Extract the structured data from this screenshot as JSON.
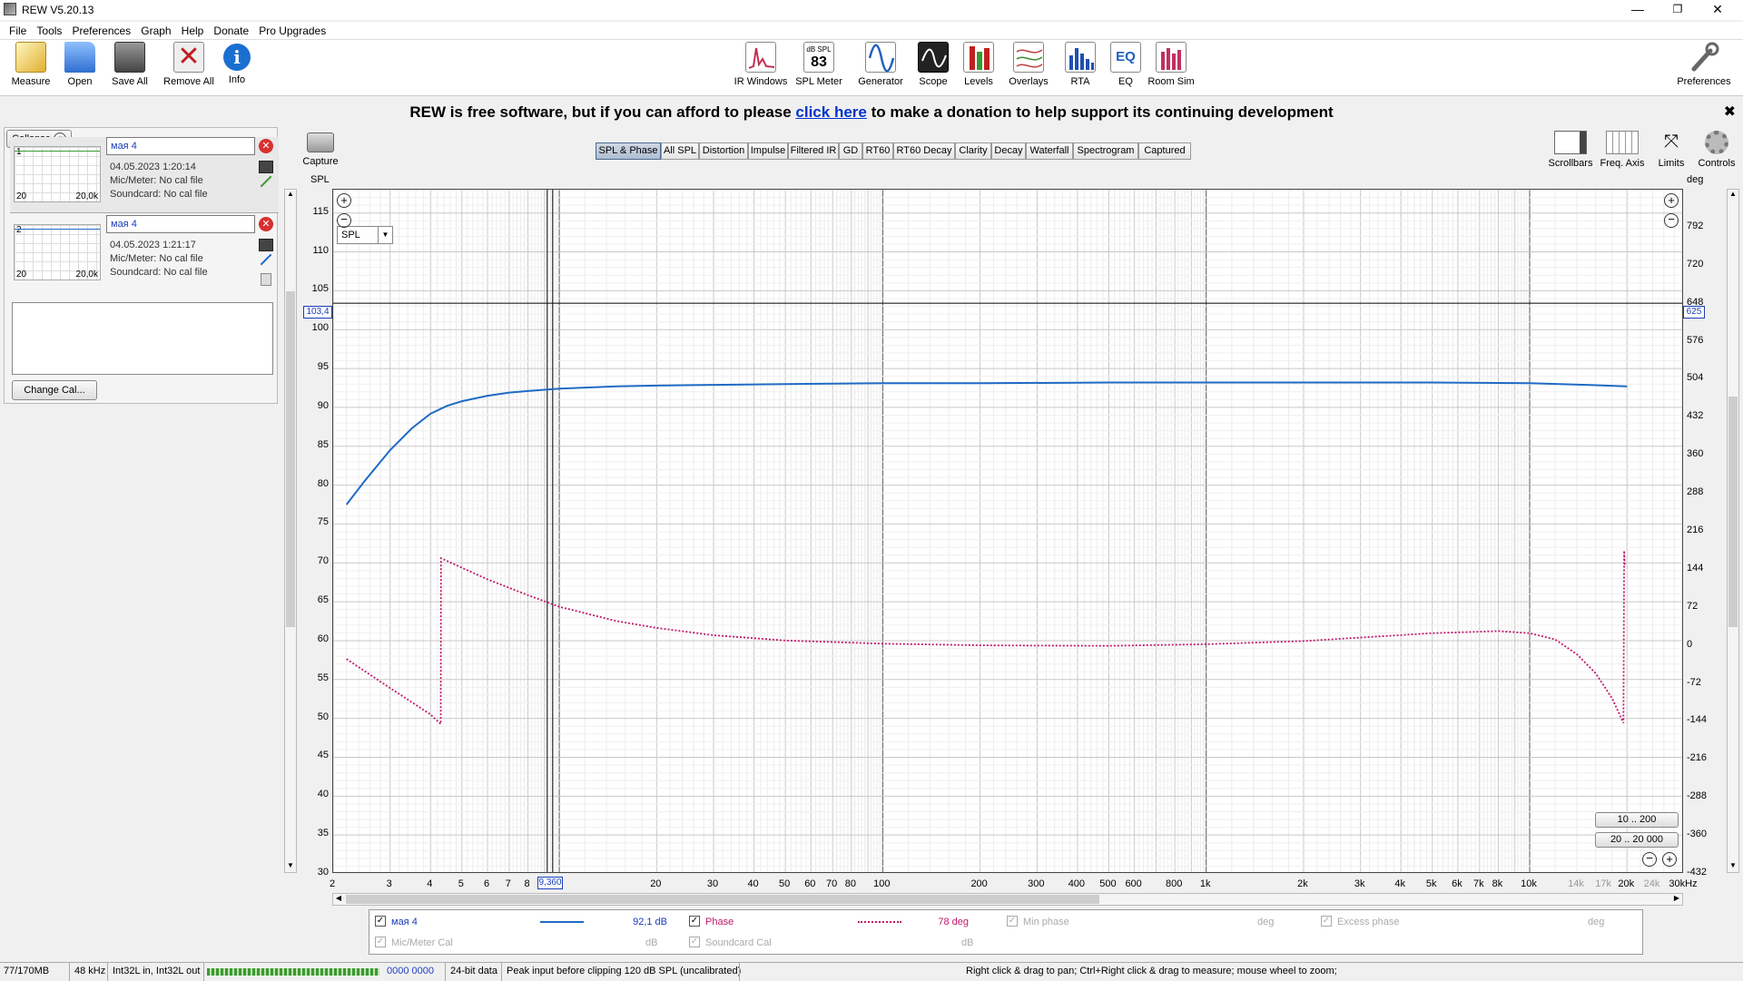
{
  "window": {
    "title": "REW V5.20.13",
    "min": "—",
    "max": "❐",
    "close": "✕"
  },
  "menu": [
    "File",
    "Tools",
    "Preferences",
    "Graph",
    "Help",
    "Donate",
    "Pro Upgrades"
  ],
  "toolbar_left": [
    {
      "label": "Measure",
      "icon": "measure-icon",
      "color": "#d8b030"
    },
    {
      "label": "Open",
      "icon": "folder-icon",
      "color": "#3a7bd5"
    },
    {
      "label": "Save All",
      "icon": "save-icon",
      "color": "#555555"
    },
    {
      "label": "Remove All",
      "icon": "remove-icon",
      "color": "#c02020"
    },
    {
      "label": "Info",
      "icon": "info-icon",
      "color": "#1a6fd0"
    }
  ],
  "toolbar_center": [
    {
      "label": "IR Windows",
      "icon": "ir-windows-icon",
      "color": "#c03050"
    },
    {
      "label": "SPL Meter",
      "icon": "spl-meter-icon",
      "color": "#333333",
      "top": "dB SPL",
      "value": "83"
    },
    {
      "label": "Generator",
      "icon": "generator-icon",
      "color": "#2060c0"
    },
    {
      "label": "Scope",
      "icon": "scope-icon",
      "color": "#222222"
    },
    {
      "label": "Levels",
      "icon": "levels-icon",
      "color": "#c02020"
    },
    {
      "label": "Overlays",
      "icon": "overlays-icon",
      "color": "#c04040"
    },
    {
      "label": "RTA",
      "icon": "rta-icon",
      "color": "#2050b0"
    },
    {
      "label": "EQ",
      "icon": "eq-icon",
      "color": "#2060c0"
    },
    {
      "label": "Room Sim",
      "icon": "room-sim-icon",
      "color": "#c03060"
    }
  ],
  "toolbar_right": {
    "label": "Preferences",
    "icon": "wrench-icon"
  },
  "banner": {
    "prefix": "REW is free software, but if you can afford to please ",
    "link": "click here",
    "suffix": " to make a donation to help support its continuing development",
    "close": "✖"
  },
  "panel": {
    "collapse": "Collapse",
    "collapse_glyph": "«",
    "change_cal": "Change Cal...",
    "measurements": [
      {
        "index": "1",
        "name": "мая 4",
        "date": "04.05.2023 1:20:14",
        "mic": "Mic/Meter: No cal file",
        "soundcard": "Soundcard: No cal file",
        "x0": "20",
        "x1": "20,0k"
      },
      {
        "index": "2",
        "name": "мая 4",
        "date": "04.05.2023 1:21:17",
        "mic": "Mic/Meter: No cal file",
        "soundcard": "Soundcard: No cal file",
        "x0": "20",
        "x1": "20,0k"
      }
    ]
  },
  "capture": {
    "label": "Capture",
    "icon": "camera-icon"
  },
  "graph_tabs": [
    "SPL & Phase",
    "All SPL",
    "Distortion",
    "Impulse",
    "Filtered IR",
    "GD",
    "RT60",
    "RT60 Decay",
    "Clarity",
    "Decay",
    "Waterfall",
    "Spectrogram",
    "Captured"
  ],
  "graph_tools": [
    {
      "label": "Scrollbars",
      "icon": "scrollbars-icon"
    },
    {
      "label": "Freq. Axis",
      "icon": "freq-axis-icon"
    },
    {
      "label": "Limits",
      "icon": "limits-icon"
    },
    {
      "label": "Controls",
      "icon": "gear-icon"
    }
  ],
  "axis": {
    "left_title": "SPL",
    "right_title": "deg",
    "spl_selector": "SPL",
    "cursor_left": "103,4",
    "cursor_right": "625",
    "cursor_x": "9,360",
    "left_ticks": [
      "115",
      "110",
      "105",
      "100",
      "95",
      "90",
      "85",
      "80",
      "75",
      "70",
      "65",
      "60",
      "55",
      "50",
      "45",
      "40",
      "35",
      "30"
    ],
    "right_ticks": [
      "792",
      "720",
      "648",
      "576",
      "504",
      "432",
      "360",
      "288",
      "216",
      "144",
      "72",
      "0",
      "-72",
      "-144",
      "-216",
      "-288",
      "-360",
      "-432"
    ],
    "x_ticks": [
      "2",
      "3",
      "4",
      "5",
      "6",
      "7",
      "8",
      "20",
      "30",
      "40",
      "50",
      "60",
      "70",
      "80",
      "100",
      "200",
      "300",
      "400",
      "500",
      "600",
      "800",
      "1k",
      "2k",
      "3k",
      "4k",
      "5k",
      "6k",
      "7k",
      "8k",
      "10k",
      "14k",
      "17k",
      "20k",
      "24k",
      "30kHz"
    ],
    "range_buttons": [
      "10 .. 200",
      "20 .. 20 000"
    ]
  },
  "chart_data": {
    "type": "line",
    "x_scale": "log",
    "xlim": [
      2,
      30000
    ],
    "ylim": [
      30,
      118
    ],
    "y2lim": [
      -432,
      864
    ],
    "series": [
      {
        "name": "мая 4",
        "axis": "SPL",
        "color": "#1f6bc4",
        "x": [
          2.2,
          2.5,
          3,
          3.5,
          4,
          4.5,
          5,
          6,
          7,
          8,
          10,
          15,
          20,
          30,
          50,
          100,
          200,
          500,
          1000,
          2000,
          5000,
          10000,
          15000,
          20000
        ],
        "y": [
          77.5,
          80.5,
          84.5,
          87.3,
          89.2,
          90.2,
          90.8,
          91.5,
          91.9,
          92.1,
          92.4,
          92.7,
          92.8,
          92.9,
          93.0,
          93.1,
          93.1,
          93.2,
          93.2,
          93.2,
          93.2,
          93.1,
          92.9,
          92.7
        ]
      },
      {
        "name": "Phase",
        "axis": "deg",
        "color": "#c0186c",
        "x": [
          2.2,
          3,
          4,
          4.3,
          4.31,
          5,
          6,
          8,
          10,
          15,
          20,
          30,
          50,
          100,
          200,
          500,
          1000,
          2000,
          5000,
          8000,
          10000,
          12000,
          14000,
          16000,
          18000,
          19500,
          19600,
          19700
        ],
        "y": [
          -25,
          -80,
          -130,
          -148,
          166,
          148,
          126,
          96,
          74,
          47,
          34,
          20,
          10,
          4,
          1,
          0,
          3,
          9,
          24,
          28,
          24,
          12,
          -16,
          -52,
          -100,
          -146,
          180,
          150
        ]
      }
    ]
  },
  "legend": {
    "items": [
      {
        "name": "мая 4",
        "value": "92,1 dB",
        "color": "#1f6bc4",
        "checked": true
      },
      {
        "name": "Phase",
        "value": "78 deg",
        "color": "#c0186c",
        "checked": true
      },
      {
        "name": "Min phase",
        "value": "deg",
        "checked": true,
        "disabled": true
      },
      {
        "name": "Excess phase",
        "value": "deg",
        "checked": true,
        "disabled": true
      },
      {
        "name": "Mic/Meter Cal",
        "value": "dB",
        "checked": true,
        "disabled": true
      },
      {
        "name": "Soundcard Cal",
        "value": "dB",
        "checked": true,
        "disabled": true
      }
    ]
  },
  "status": {
    "memory": "77/170MB",
    "rate": "48 kHz",
    "io": "Int32L in, Int32L out",
    "meters": "0000 0000",
    "bits": "24-bit data",
    "peak": "Peak input before clipping 120 dB SPL (uncalibrated)",
    "hint": "Right click & drag to pan; Ctrl+Right click & drag to measure; mouse wheel to zoom;"
  }
}
